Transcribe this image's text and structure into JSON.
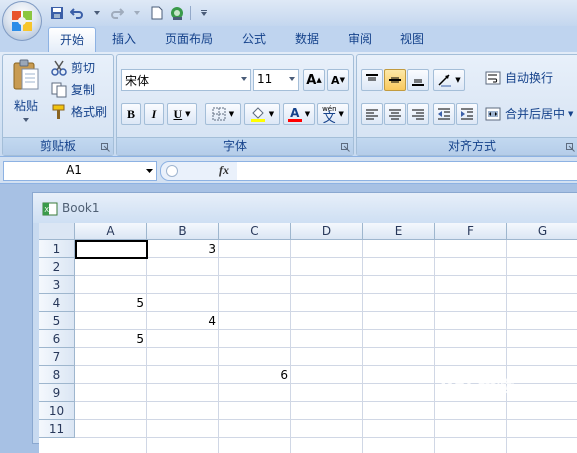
{
  "title_bar": {
    "qat": {
      "save_icon": "save-icon",
      "undo_icon": "undo-icon",
      "redo_icon": "redo-icon",
      "new_icon": "new-doc-icon",
      "print_icon": "print-preview-icon",
      "customize_icon": "customize-qat-icon"
    }
  },
  "tabs": [
    "开始",
    "插入",
    "页面布局",
    "公式",
    "数据",
    "审阅",
    "视图"
  ],
  "active_tab": "开始",
  "clipboard": {
    "paste_label": "粘贴",
    "cut_label": "剪切",
    "copy_label": "复制",
    "format_painter_label": "格式刷",
    "group_label": "剪贴板"
  },
  "font": {
    "font_name": "宋体",
    "font_size": "11",
    "bold": "B",
    "italic": "I",
    "underline": "U",
    "grow_label": "A",
    "shrink_label": "A",
    "font_color_label": "A",
    "phonetic_label": "文",
    "phonetic_sup": "wén",
    "group_label": "字体",
    "fill_color": "#ffff00",
    "font_color": "#ff0000"
  },
  "alignment": {
    "wrap_text_label": "自动换行",
    "merge_center_label": "合并后居中",
    "group_label": "对齐方式"
  },
  "formula_bar": {
    "name_box": "A1",
    "fx_label": "fx",
    "formula": ""
  },
  "workbook": {
    "title": "Book1",
    "columns": [
      "A",
      "B",
      "C",
      "D",
      "E",
      "F",
      "G"
    ],
    "rows": [
      "1",
      "2",
      "3",
      "4",
      "5",
      "6",
      "7",
      "8",
      "9",
      "10",
      "11"
    ],
    "cells": {
      "B1": "3",
      "A4": "5",
      "B5": "4",
      "A6": "5",
      "C8": "6"
    },
    "selected_cell": "A1"
  },
  "watermark": {
    "text": "Bai 经验"
  }
}
